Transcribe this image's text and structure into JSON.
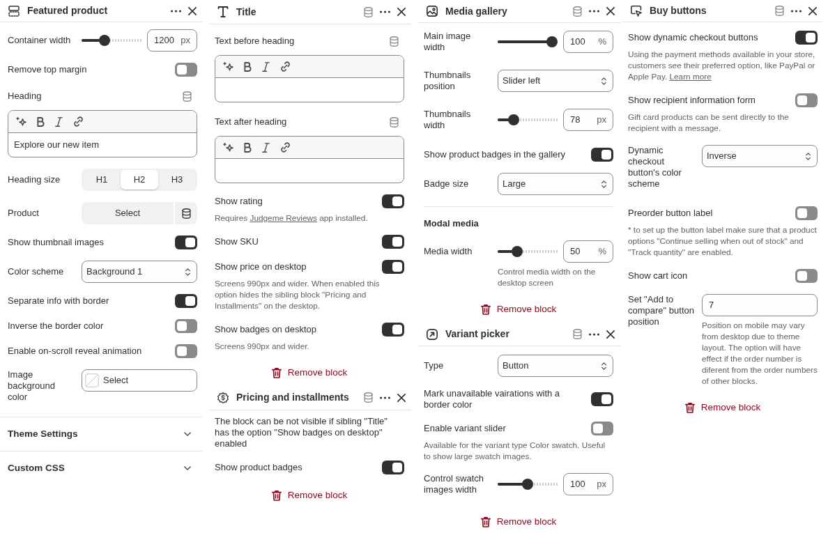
{
  "columns": [
    {
      "panels": [
        {
          "kind": "featured",
          "title": "Featured product",
          "data_source": false,
          "settings": [
            {
              "kind": "slider",
              "label": "Container width",
              "level": 0.35,
              "value": "1200",
              "unit": "px"
            },
            {
              "kind": "toggle",
              "label": "Remove top margin",
              "on": false
            },
            {
              "kind": "richtext",
              "label": "Heading",
              "data_source": true,
              "value": "Explore our new item"
            },
            {
              "kind": "segmented",
              "label": "Heading size",
              "options": [
                {
                  "label": "H1",
                  "selected": false
                },
                {
                  "label": "H2",
                  "selected": true
                },
                {
                  "label": "H3",
                  "selected": false
                }
              ]
            },
            {
              "kind": "picker",
              "label": "Product",
              "button": "Select",
              "data_source": true
            },
            {
              "kind": "toggle",
              "label": "Show thumbnail images",
              "on": true
            },
            {
              "kind": "select",
              "label": "Color scheme",
              "value": "Background 1"
            },
            {
              "kind": "toggle",
              "label": "Separate info with border",
              "on": true
            },
            {
              "kind": "toggle",
              "label": "Inverse the border color",
              "on": false
            },
            {
              "kind": "toggle",
              "label": "Enable on-scroll reveal animation",
              "on": false
            },
            {
              "kind": "color",
              "label": "Image background color",
              "value": "Select"
            }
          ],
          "sections": [
            {
              "title": "Theme Settings",
              "expanded": false
            },
            {
              "title": "Custom CSS",
              "expanded": false
            }
          ]
        }
      ]
    },
    {
      "panels": [
        {
          "kind": "title",
          "title": "Title",
          "data_source": true,
          "settings": [
            {
              "kind": "richtext",
              "label": "Text before heading",
              "data_source": true
            },
            {
              "kind": "richtext",
              "label": "Text after heading",
              "data_source": true
            },
            {
              "kind": "toggle",
              "label": "Show rating",
              "on": true,
              "description": [
                {
                  "kind": "text",
                  "text": "Requires "
                },
                {
                  "kind": "link",
                  "text": "Judgeme Reviews"
                },
                {
                  "kind": "text",
                  "text": " app installed."
                }
              ]
            },
            {
              "kind": "toggle",
              "label": "Show SKU",
              "on": true
            },
            {
              "kind": "toggle",
              "label": "Show price on desktop",
              "on": true,
              "description": "Screens 990px and wider. When enabled this option hides the sibling block \"Pricing and Installments\" on the desktop."
            },
            {
              "kind": "toggle",
              "label": "Show badges on desktop",
              "on": true,
              "description": "Screens 990px and wider."
            }
          ],
          "remove_label": "Remove block"
        },
        {
          "kind": "pricing",
          "title": "Pricing and installments",
          "data_source": true,
          "settings": [
            {
              "kind": "note",
              "text": "The block can be not visible if sibling \"Title\" has the option \"Show badges on desktop\" enabled"
            },
            {
              "kind": "toggle",
              "label": "Show product badges",
              "on": true
            }
          ],
          "remove_label": "Remove block"
        }
      ]
    },
    {
      "panels": [
        {
          "kind": "gallery",
          "title": "Media gallery",
          "data_source": true,
          "settings": [
            {
              "kind": "slider",
              "label": "Main image width",
              "level": 1,
              "value": "100",
              "unit": "%"
            },
            {
              "kind": "select",
              "label": "Thumbnails position",
              "value": "Slider left"
            },
            {
              "kind": "slider",
              "label": "Thumbnails width",
              "level": 0.21,
              "value": "78",
              "unit": "px"
            },
            {
              "kind": "toggle",
              "label": "Show product badges in the gallery",
              "on": true
            },
            {
              "kind": "select",
              "label": "Badge size",
              "value": "Large"
            },
            {
              "kind": "divider"
            },
            {
              "kind": "subheading",
              "text": "Modal media"
            },
            {
              "kind": "slider",
              "label": "Media width",
              "level": 0.28,
              "value": "50",
              "unit": "%",
              "description": "Control media width on the desktop screen"
            }
          ],
          "remove_label": "Remove block"
        },
        {
          "kind": "variant",
          "title": "Variant picker",
          "data_source": true,
          "settings": [
            {
              "kind": "select",
              "label": "Type",
              "value": "Button"
            },
            {
              "kind": "toggle",
              "label": "Mark unavailable vairations with a border color",
              "on": true
            },
            {
              "kind": "toggle",
              "label": "Enable variant slider",
              "on": false,
              "description": "Available for the variant type Color swatch. Useful to show large swatch images."
            },
            {
              "kind": "slider",
              "label": "Control swatch images width",
              "level": 0.5,
              "value": "100",
              "unit": "px"
            }
          ],
          "remove_label": "Remove block"
        }
      ]
    },
    {
      "panels": [
        {
          "kind": "buttons",
          "title": "Buy buttons",
          "data_source": true,
          "settings": [
            {
              "kind": "toggle",
              "label": "Show dynamic checkout buttons",
              "on": true,
              "description": [
                {
                  "kind": "text",
                  "text": "Using the payment methods available in your store, customers see their preferred option, like PayPal or Apple Pay. "
                },
                {
                  "kind": "link",
                  "text": "Learn more"
                }
              ]
            },
            {
              "kind": "toggle",
              "label": "Show recipient information form",
              "on": false,
              "description": "Gift card products can be sent directly to the recipient with a message."
            },
            {
              "kind": "select",
              "label": "Dynamic checkout button's color scheme",
              "value": "Inverse"
            },
            {
              "kind": "toggle",
              "label": "Preorder button label",
              "on": false,
              "description": "* to set up the button label make sure that a product options \"Continue selling when out of stock\" and \"Track quantity\" are enabled."
            },
            {
              "kind": "toggle",
              "label": "Show cart icon",
              "on": false
            },
            {
              "kind": "number",
              "label": "Set \"Add to compare\" button position",
              "value": "7",
              "description": "Position on mobile may vary from desktop due to theme layout. The option will have effect if the order number is diferent from the order numbers of other blocks."
            }
          ],
          "remove_label": "Remove block"
        }
      ]
    }
  ]
}
